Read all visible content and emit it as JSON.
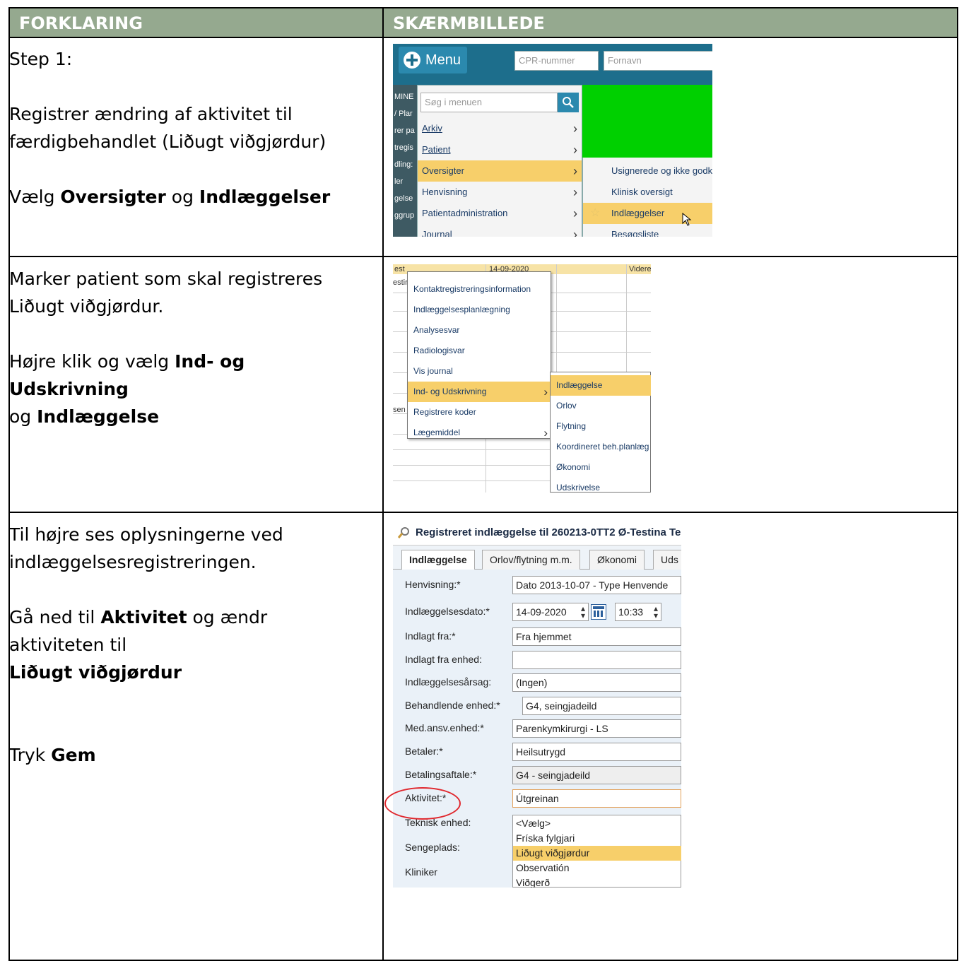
{
  "headers": {
    "explanation": "FORKLARING",
    "screenshot": "SKÆRMBILLEDE"
  },
  "rows": [
    {
      "lines": [
        [
          {
            "t": "Step 1:"
          }
        ],
        [],
        [
          {
            "t": "Registrer ændring af aktivitet til"
          }
        ],
        [
          {
            "t": "færdigbehandlet (Liðugt viðgjørdur)"
          }
        ],
        [],
        [
          {
            "t": "Vælg "
          },
          {
            "t": "Oversigter",
            "b": true
          },
          {
            "t": " og "
          },
          {
            "t": "Indlæggelser",
            "b": true
          }
        ]
      ]
    },
    {
      "lines": [
        [
          {
            "t": "Marker patient som skal registreres"
          }
        ],
        [
          {
            "t": "Liðugt viðgjørdur."
          }
        ],
        [],
        [
          {
            "t": "Højre klik og vælg "
          },
          {
            "t": "Ind- og Udskrivning",
            "b": true
          }
        ],
        [
          {
            "t": "og "
          },
          {
            "t": "Indlæggelse",
            "b": true
          }
        ]
      ]
    },
    {
      "lines": [
        [
          {
            "t": "Til højre ses oplysningerne ved"
          }
        ],
        [
          {
            "t": "indlæggelsesregistreringen."
          }
        ],
        [],
        [
          {
            "t": "Gå ned til "
          },
          {
            "t": "Aktivitet",
            "b": true
          },
          {
            "t": " og ændr"
          }
        ],
        [
          {
            "t": "aktiviteten til"
          }
        ],
        [
          {
            "t": "Liðugt viðgjørdur",
            "b": true
          }
        ],
        [],
        [],
        [
          {
            "t": "Tryk "
          },
          {
            "t": "Gem",
            "b": true
          }
        ]
      ]
    }
  ],
  "shot1": {
    "menu_button": "Menu",
    "cpr_placeholder": "CPR-nummer",
    "fornavn_placeholder": "Fornavn",
    "left_strip": [
      "MINE",
      "/ Plar",
      "rer pa",
      "tregis",
      "dling:",
      "ler",
      "gelse",
      "ggrup"
    ],
    "search_placeholder": "Søg i menuen",
    "items": [
      "Arkiv",
      "Patient",
      "Oversigter",
      "Henvisning",
      "Patientadministration",
      "Journal"
    ],
    "selected_item": "Oversigter",
    "sub_items": [
      "Usignerede og ikke godk",
      "Klinisk oversigt",
      "Indlæggelser",
      "Besøgsliste"
    ],
    "selected_sub": "Indlæggelser",
    "colors": {
      "accent": "#f7cf6a",
      "topbar": "#1d6e8c",
      "green": "#00d000"
    }
  },
  "shot2": {
    "top_cells": [
      "est",
      "14-09-2020",
      "Videre"
    ],
    "row_fragments": [
      "estir",
      "sen"
    ],
    "items": [
      "Kontaktregistreringsinformation",
      "Indlæggelsesplanlægning",
      "Analysesvar",
      "Radiologisvar",
      "Vis journal",
      "Ind- og Udskrivning",
      "Registrere koder",
      "Lægemiddel"
    ],
    "selected_item": "Ind- og Udskrivning",
    "sub_items": [
      "Indlæggelse",
      "Orlov",
      "Flytning",
      "Koordineret beh.planlæg",
      "Økonomi",
      "Udskrivelse"
    ],
    "selected_sub": "Indlæggelse"
  },
  "shot3": {
    "title": "Registreret indlæggelse til 260213-0TT2 Ø-Testina Te",
    "tabs": [
      "Indlæggelse",
      "Orlov/flytning m.m.",
      "Økonomi",
      "Uds"
    ],
    "active_tab": "Indlæggelse",
    "fields": [
      {
        "label": "Henvisning:*",
        "value": "Dato 2013-10-07 - Type Henvende"
      },
      {
        "label": "Indlæggelsesdato:*",
        "value": "14-09-2020",
        "time": "10:33"
      },
      {
        "label": "Indlagt fra:*",
        "value": "Fra hjemmet"
      },
      {
        "label": "Indlagt fra enhed:",
        "value": ""
      },
      {
        "label": "Indlæggelsesårsag:",
        "value": "(Ingen)"
      },
      {
        "label": "Behandlende enhed:*",
        "value": "G4, seingjadeild"
      },
      {
        "label": "Med.ansv.enhed:*",
        "value": "Parenkymkirurgi - LS"
      },
      {
        "label": "Betaler:*",
        "value": "Heilsutrygd"
      },
      {
        "label": "Betalingsaftale:*",
        "value": "G4 - seingjadeild"
      },
      {
        "label": "Aktivitet:*",
        "value": "Útgreinan"
      }
    ],
    "extra_labels": [
      "Teknisk enhed:",
      "Sengeplads:",
      "Kliniker"
    ],
    "activity_options": [
      "<Vælg>",
      "Fríska fylgjari",
      "Liðugt viðgjørdur",
      "Observatión",
      "Viðgerð"
    ],
    "selected_option": "Liðugt viðgjørdur",
    "highlight_color": "#e0282e"
  }
}
